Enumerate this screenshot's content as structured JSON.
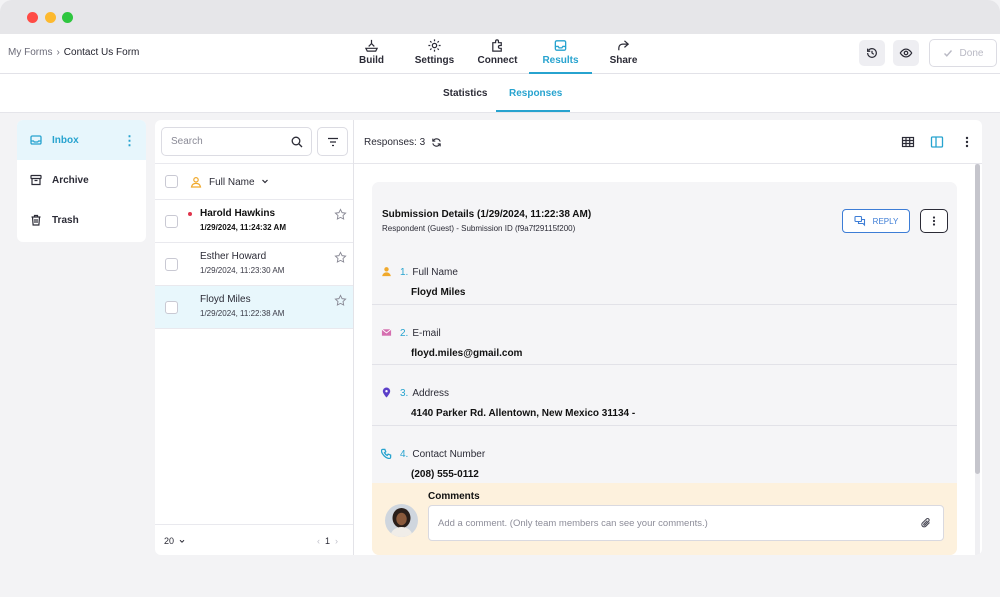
{
  "breadcrumb": {
    "parent": "My Forms",
    "separator": "›",
    "current": "Contact Us Form"
  },
  "nav": {
    "tabs": [
      {
        "label": "Build",
        "icon": "build-icon"
      },
      {
        "label": "Settings",
        "icon": "gear-icon"
      },
      {
        "label": "Connect",
        "icon": "puzzle-icon"
      },
      {
        "label": "Results",
        "icon": "inbox-tray-icon",
        "active": true
      },
      {
        "label": "Share",
        "icon": "share-arrow-icon"
      }
    ]
  },
  "toolbar": {
    "history_icon": "history-icon",
    "preview_icon": "eye-icon",
    "done_label": "Done"
  },
  "subtabs": {
    "statistics": "Statistics",
    "responses": "Responses",
    "active": "Responses"
  },
  "folders": [
    {
      "label": "Inbox",
      "icon": "inbox-icon",
      "active": true
    },
    {
      "label": "Archive",
      "icon": "archive-icon"
    },
    {
      "label": "Trash",
      "icon": "trash-icon"
    }
  ],
  "list": {
    "search_placeholder": "Search",
    "sort_label": "Full Name",
    "rows": [
      {
        "name": "Harold Hawkins",
        "date": "1/29/2024, 11:24:32 AM",
        "unread": true,
        "selected": false
      },
      {
        "name": "Esther Howard",
        "date": "1/29/2024, 11:23:30 AM",
        "unread": false,
        "selected": false
      },
      {
        "name": "Floyd Miles",
        "date": "1/29/2024, 11:22:38 AM",
        "unread": false,
        "selected": true
      }
    ],
    "per_page": "20",
    "page": "1"
  },
  "detail": {
    "responses_label": "Responses: 3",
    "title": "Submission Details (1/29/2024, 11:22:38 AM)",
    "subtitle": "Respondent (Guest) - Submission ID (f9a7f29115f200)",
    "reply_label": "REPLY",
    "fields": [
      {
        "num": "1.",
        "label": "Full Name",
        "value": "Floyd Miles",
        "icon": "person-icon",
        "color": "#f0a92c"
      },
      {
        "num": "2.",
        "label": "E-mail",
        "value": "floyd.miles@gmail.com",
        "icon": "envelope-icon",
        "color": "#d56fb0"
      },
      {
        "num": "3.",
        "label": "Address",
        "value": "4140 Parker Rd. Allentown, New Mexico 31134 -",
        "icon": "map-pin-icon",
        "color": "#5b3fc9"
      },
      {
        "num": "4.",
        "label": "Contact Number",
        "value": "(208) 555-0112",
        "icon": "phone-icon",
        "color": "#27a3cf"
      }
    ],
    "comments_title": "Comments",
    "comment_placeholder": "Add a comment. (Only team members can see your comments.)"
  },
  "colors": {
    "accent": "#27a3cf",
    "reply": "#3d7dd6",
    "unread": "#e0344c",
    "comment_bg": "#fdf1dd"
  }
}
